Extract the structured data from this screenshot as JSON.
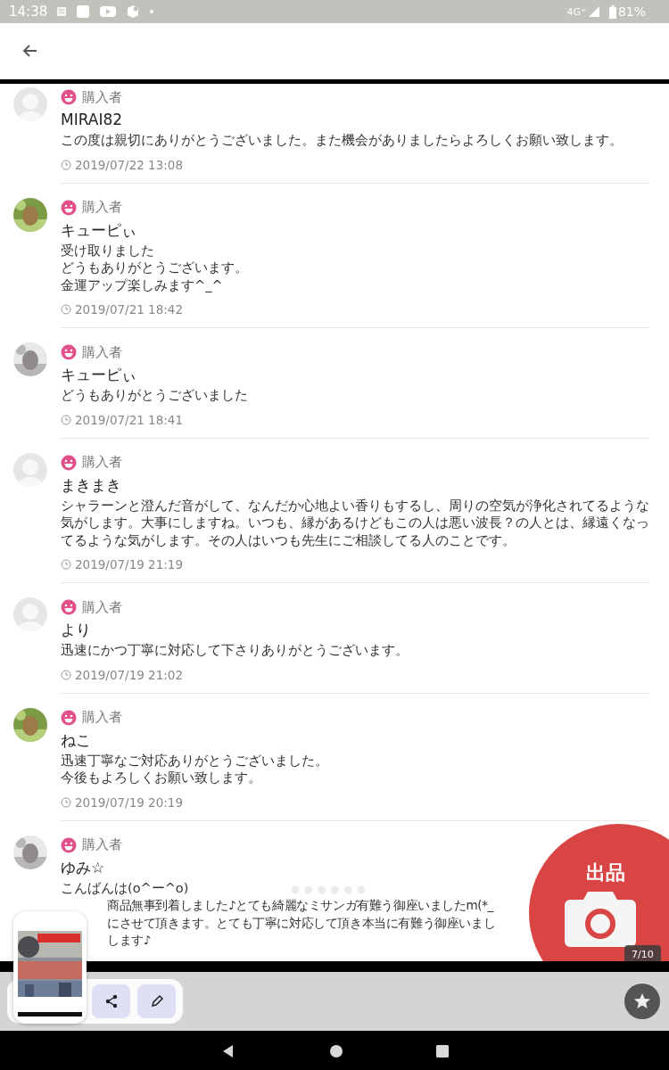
{
  "status_bar": {
    "time": "14:38",
    "network": "4G⁺",
    "battery": "81%"
  },
  "reviews": [
    {
      "kind": "default",
      "role": "購入者",
      "name": "MIRAI82",
      "lines": [
        {
          "text": "この度は親切にありがとうございました。また機会がありましたらよろしくお願い致します。",
          "cut": false
        }
      ],
      "date": "2019/07/22 13:08"
    },
    {
      "role": "購入者",
      "name": "キューピぃ",
      "lines": [
        {
          "text": "受け取りました",
          "cut": false
        },
        {
          "text": "どうもありがとうございます。",
          "cut": false
        },
        {
          "text": "金運アップ楽しみます^_^",
          "cut": false
        }
      ],
      "date": "2019/07/21 18:42"
    },
    {
      "role": "購入者",
      "name": "キューピぃ",
      "lines": [
        {
          "text": "どうもありがとうございました",
          "cut": false
        }
      ],
      "date": "2019/07/21 18:41"
    },
    {
      "kind": "default",
      "role": "購入者",
      "name": "まきまき",
      "lines": [
        {
          "text": "シャラーンと澄んだ音がして、なんだか心地よい香りもするし、周りの空気が浄化されてるような気がします。大事にしますね。いつも、縁があるけどもこの人は悪い波長？の人とは、縁遠くなってるような気がします。その人はいつも先生にご相談してる人のことです。",
          "cut": false
        }
      ],
      "date": "2019/07/19 21:19"
    },
    {
      "kind": "default",
      "role": "購入者",
      "name": "より",
      "lines": [
        {
          "text": "迅速にかつ丁寧に対応して下さりありがとうございます。",
          "cut": false
        }
      ],
      "date": "2019/07/19 21:02"
    },
    {
      "role": "購入者",
      "name": "ねこ",
      "lines": [
        {
          "text": "迅速丁寧なご対応ありがとうございました。",
          "cut": false
        },
        {
          "text": "今後もよろしくお願い致します。",
          "cut": false
        }
      ],
      "date": "2019/07/19 20:19"
    },
    {
      "role": "購入者",
      "name": "ゆみ☆",
      "lines": [
        {
          "text": "こんばんは(o^ー^o)",
          "cut": false
        },
        {
          "text": "商品無事到着しました♪とても綺麗なミサンガ有難う御座いましたm(*_",
          "cut": true
        },
        {
          "text": "にさせて頂きます。とても丁寧に対応して頂き本当に有難う御座いまし",
          "cut": true
        },
        {
          "text": "します♪",
          "cut": true
        }
      ]
    }
  ],
  "fab": {
    "label": "出品"
  },
  "counter": "7/10"
}
